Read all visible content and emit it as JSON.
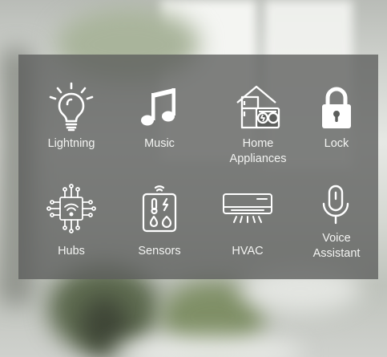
{
  "tiles": [
    {
      "label": "Lightning",
      "icon": "light-bulb-icon"
    },
    {
      "label": "Music",
      "icon": "music-note-icon"
    },
    {
      "label": "Home\nAppliances",
      "icon": "home-appliances-icon"
    },
    {
      "label": "Lock",
      "icon": "padlock-icon"
    },
    {
      "label": "Hubs",
      "icon": "hub-chip-icon"
    },
    {
      "label": "Sensors",
      "icon": "sensor-panel-icon"
    },
    {
      "label": "HVAC",
      "icon": "air-conditioner-icon"
    },
    {
      "label": "Voice\nAssistant",
      "icon": "microphone-icon"
    }
  ],
  "colors": {
    "panel": "#5c5e5c",
    "icon": "#ffffff",
    "text": "#f3f4f2"
  }
}
